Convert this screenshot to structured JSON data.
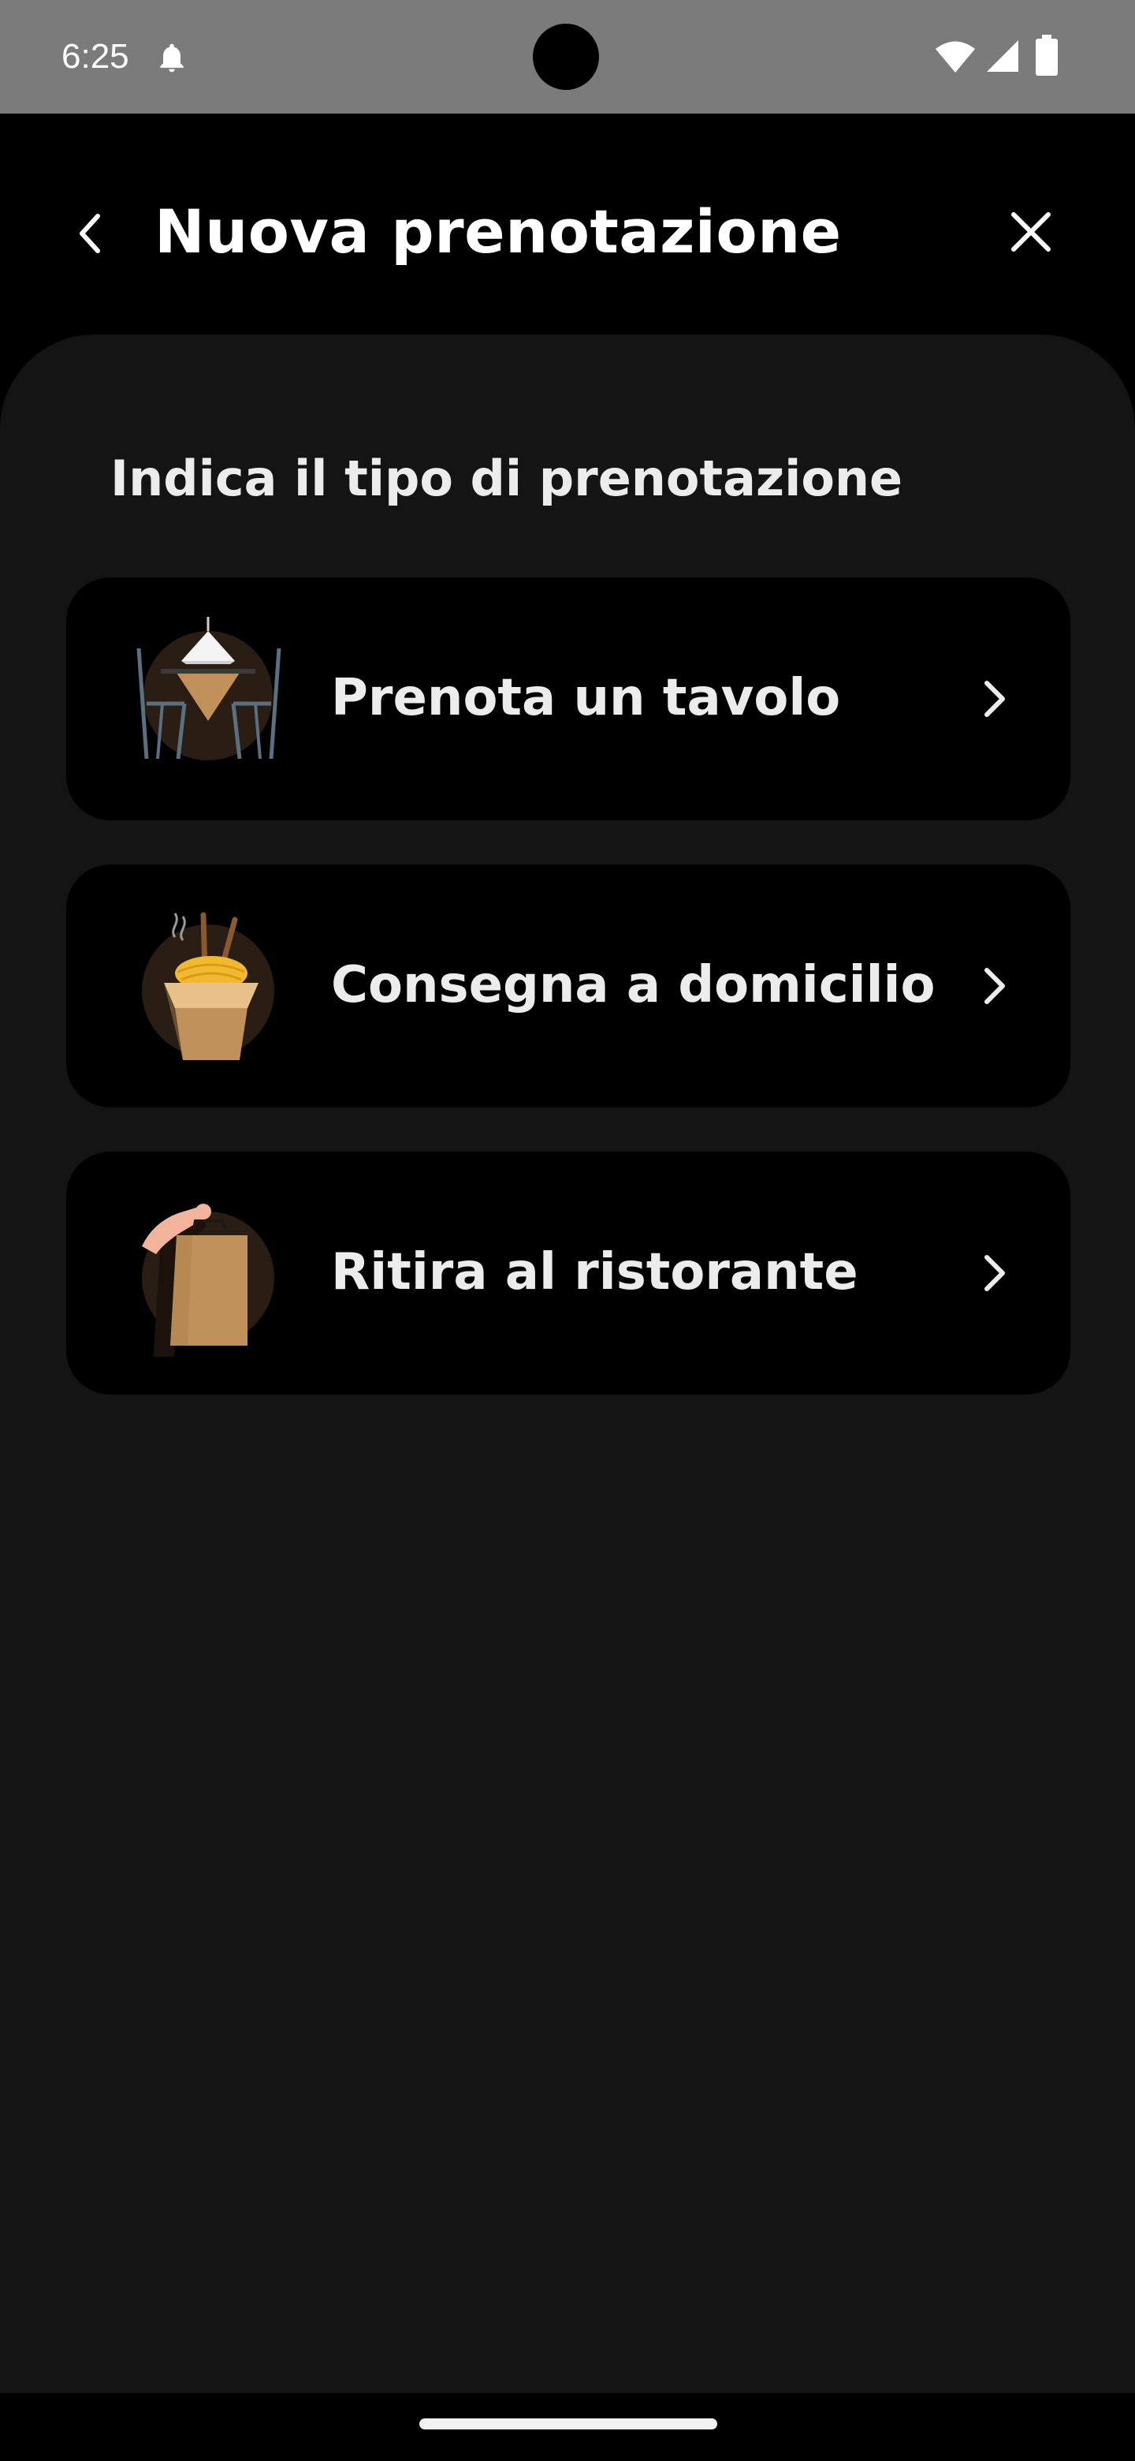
{
  "status_bar": {
    "time": "6:25",
    "icons": [
      "bell-icon",
      "wifi-icon",
      "signal-icon",
      "battery-icon"
    ]
  },
  "header": {
    "title": "Nuova prenotazione",
    "back_icon": "chevron-left-icon",
    "close_icon": "close-icon"
  },
  "content": {
    "section_title": "Indica il tipo di prenotazione",
    "options": [
      {
        "label": "Prenota un tavolo",
        "icon": "restaurant-table-illustration"
      },
      {
        "label": "Consegna a domicilio",
        "icon": "noodle-box-illustration"
      },
      {
        "label": "Ritira al ristorante",
        "icon": "takeaway-bag-illustration"
      }
    ]
  },
  "colors": {
    "status_bar": "#7b7b7b",
    "background": "#000000",
    "sheet": "#141414",
    "card": "#000000",
    "text": "#ececec",
    "accent_brown": "#c0915a",
    "noodle_yellow": "#f2b92e"
  }
}
